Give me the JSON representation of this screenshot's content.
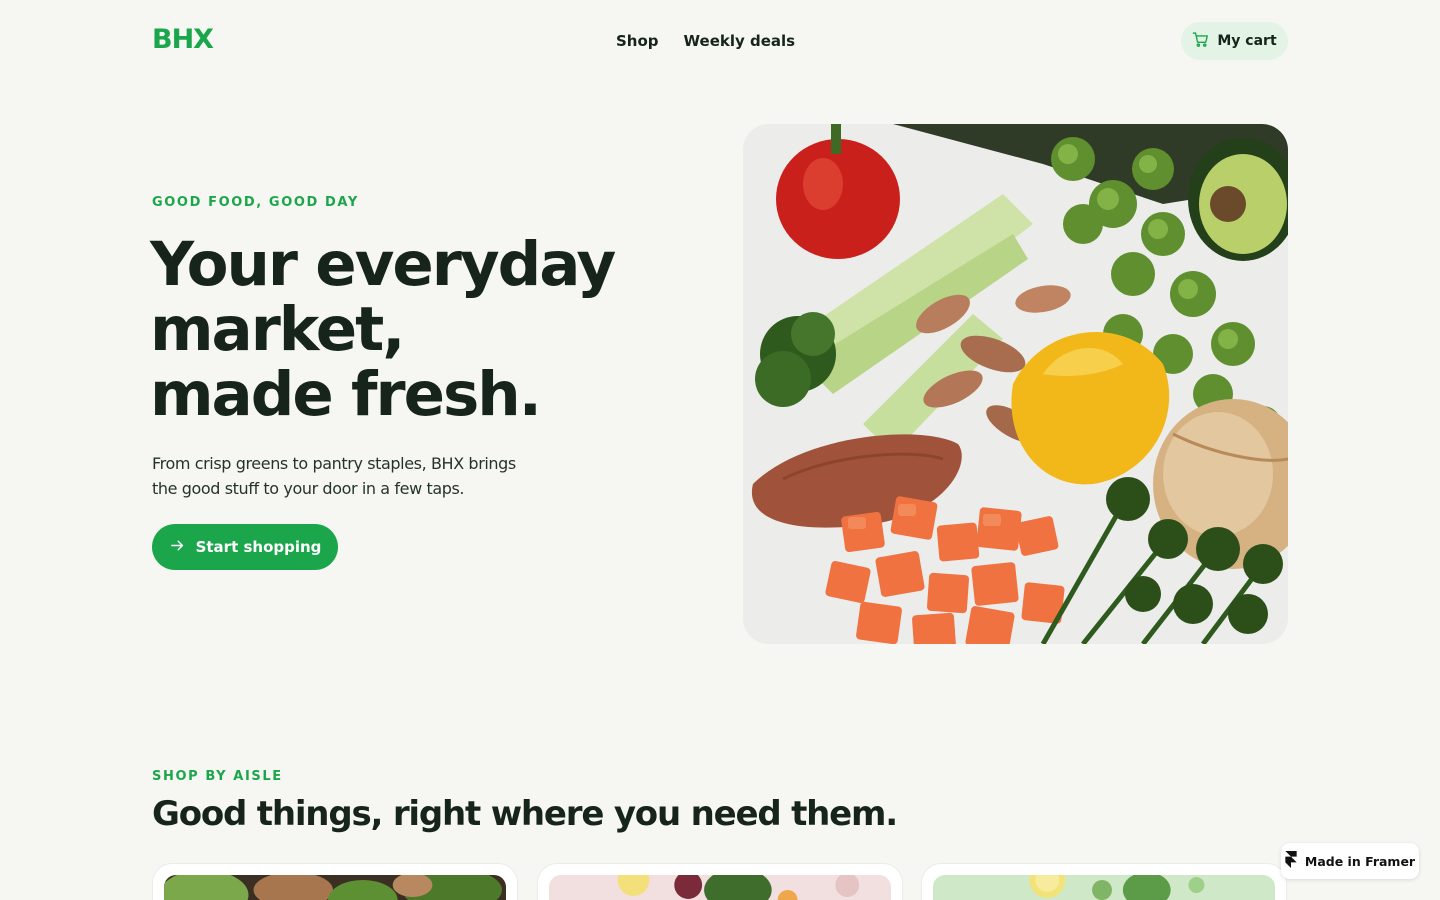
{
  "header": {
    "logo": "BHX",
    "nav": [
      "Shop",
      "Weekly deals"
    ],
    "cart_label": "My cart"
  },
  "hero": {
    "eyebrow": "GOOD FOOD, GOOD DAY",
    "title_lines": [
      "Your everyday",
      "market,",
      "made fresh."
    ],
    "subtitle_lines": [
      "From crisp greens to pantry staples, BHX brings",
      "the good stuff to your door in a few taps."
    ],
    "cta_label": "Start shopping",
    "image_subject": "assorted fresh vegetables: peppers, potatoes, sweet potato, carrots, broccoli, brussels sprouts, avocado, onion"
  },
  "aisles": {
    "eyebrow": "SHOP BY AISLE",
    "title": "Good things, right where you need them.",
    "cards": [
      {
        "thumb_subject": "vegetables"
      },
      {
        "thumb_subject": "fruit and greens"
      },
      {
        "thumb_subject": "citrus and herbs"
      }
    ]
  },
  "badge": {
    "label": "Made in Framer"
  },
  "colors": {
    "accent": "#1ca64c",
    "background": "#f6f7f2",
    "text": "#16241b",
    "cart_bg": "#e3f3e6"
  },
  "icons": [
    "cart-icon",
    "arrow-right-icon",
    "framer-logo-icon"
  ]
}
